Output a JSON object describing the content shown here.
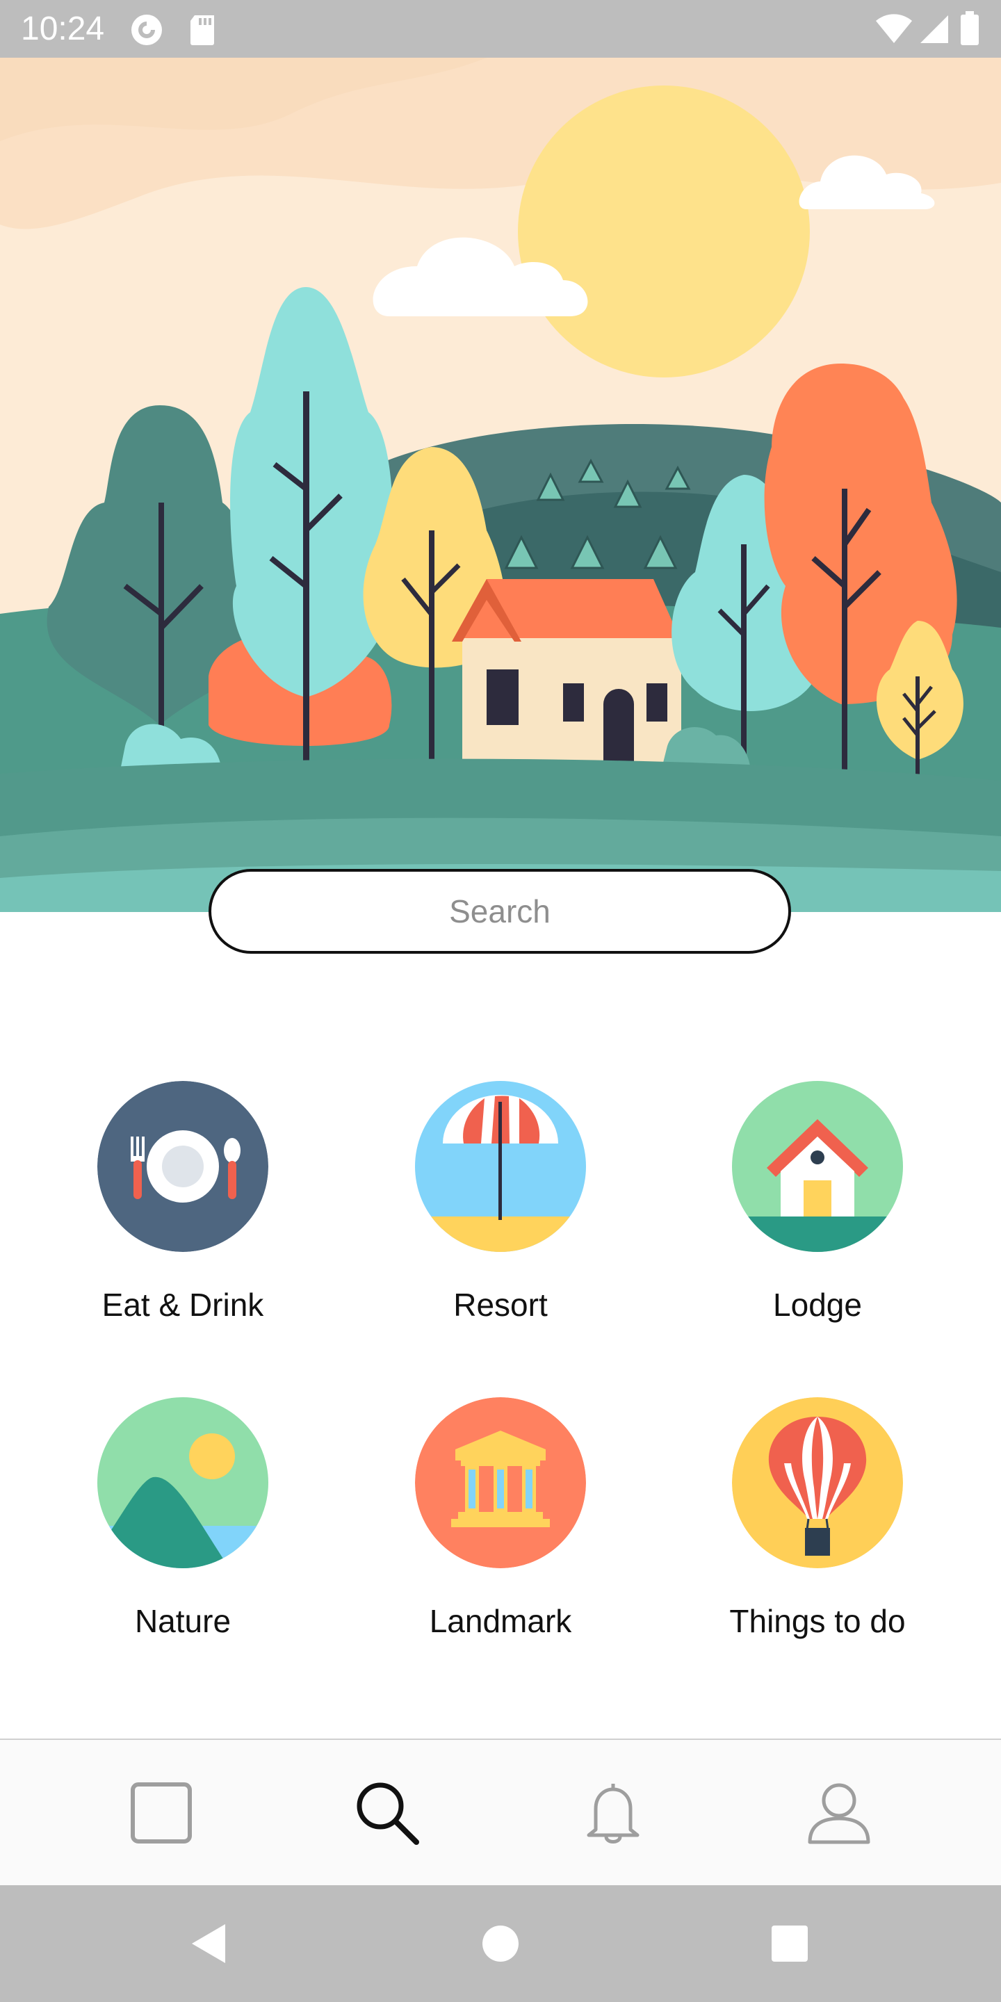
{
  "status_bar": {
    "time": "10:24",
    "icons": [
      "pocket-casts-icon",
      "sd-card-icon",
      "wifi-icon",
      "signal-icon",
      "battery-icon"
    ]
  },
  "hero": {
    "illustration": "countryside-house-landscape"
  },
  "search": {
    "placeholder": "Search"
  },
  "categories": [
    {
      "label": "Eat & Drink",
      "icon": "plate-cutlery-icon",
      "color": "#4e6680"
    },
    {
      "label": "Resort",
      "icon": "beach-umbrella-icon",
      "color": "#81d4fa"
    },
    {
      "label": "Lodge",
      "icon": "house-icon",
      "color": "#90deaa"
    },
    {
      "label": "Nature",
      "icon": "mountain-sun-icon",
      "color": "#90deaa"
    },
    {
      "label": "Landmark",
      "icon": "museum-icon",
      "color": "#ff8160"
    },
    {
      "label": "Things to do",
      "icon": "hot-air-balloon-icon",
      "color": "#ffcf57"
    }
  ],
  "bottom_nav": {
    "items": [
      "home-square-icon",
      "search-icon",
      "notifications-bell-icon",
      "profile-icon"
    ],
    "active": "search-icon"
  },
  "system_nav": {
    "items": [
      "back-icon",
      "home-icon",
      "recents-icon"
    ]
  }
}
